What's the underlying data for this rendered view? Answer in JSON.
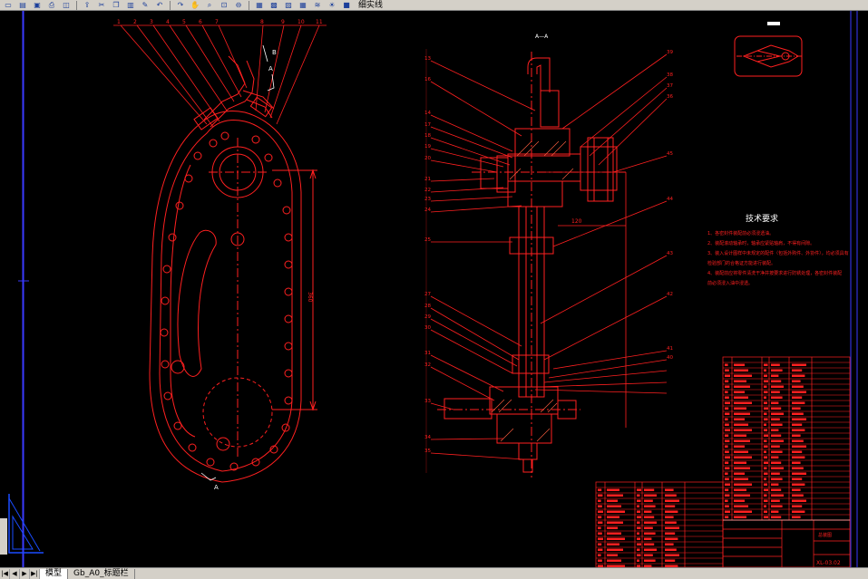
{
  "toolbar": {
    "buttons": [
      "new-icon",
      "open-icon",
      "save-icon",
      "print-icon",
      "preview-icon",
      "publish-icon",
      "cut-icon",
      "copy-icon",
      "paste-icon",
      "match-icon",
      "undo-icon",
      "redo-icon",
      "pan-icon",
      "zoom-realtime-icon",
      "zoom-window-icon",
      "zoom-previous-icon",
      "properties-icon",
      "design-center-icon",
      "tool-palette-icon",
      "calculator-icon",
      "layer-manager-icon",
      "layer-state-icon",
      "layer-color-icon"
    ],
    "layer_label": "细实线"
  },
  "tabs": [
    "模型",
    "Gb_A0_标题栏"
  ],
  "drawing": {
    "left_callouts": [
      "1",
      "2",
      "3",
      "4",
      "5",
      "6",
      "7",
      "8",
      "9",
      "10",
      "11"
    ],
    "right_callouts_left": [
      "13",
      "16",
      "14",
      "17",
      "18",
      "19",
      "20",
      "21",
      "22",
      "23",
      "24",
      "25",
      "27",
      "28",
      "29",
      "30",
      "31",
      "32",
      "33",
      "34",
      "35"
    ],
    "right_callouts_right": [
      "39",
      "38",
      "37",
      "36",
      "45",
      "44",
      "43",
      "42",
      "41",
      "40"
    ],
    "section_label": "A—A",
    "view_b": "B",
    "view_a_top": "A",
    "view_a_bottom": "A",
    "dim_vertical": "360",
    "dim_horizontal": "120",
    "tech_title": "技术要求",
    "tech_lines": [
      "1、各密封件装配前必须浸透油。",
      "2、装配滚动轴承时，轴承应紧贴轴肩，不得有间隙。",
      "3、装入设计图样中未规定的配件（包括外购件、外协件），均必须具有",
      "检验部门的合格证方能进行装配。",
      "4、装配前应将零件清洗干净并按要求进行防锈处理，各密封件装配",
      "前必须浸入油中浸透。"
    ],
    "title_name": "总装图",
    "drawing_no": "XL-03.02"
  }
}
